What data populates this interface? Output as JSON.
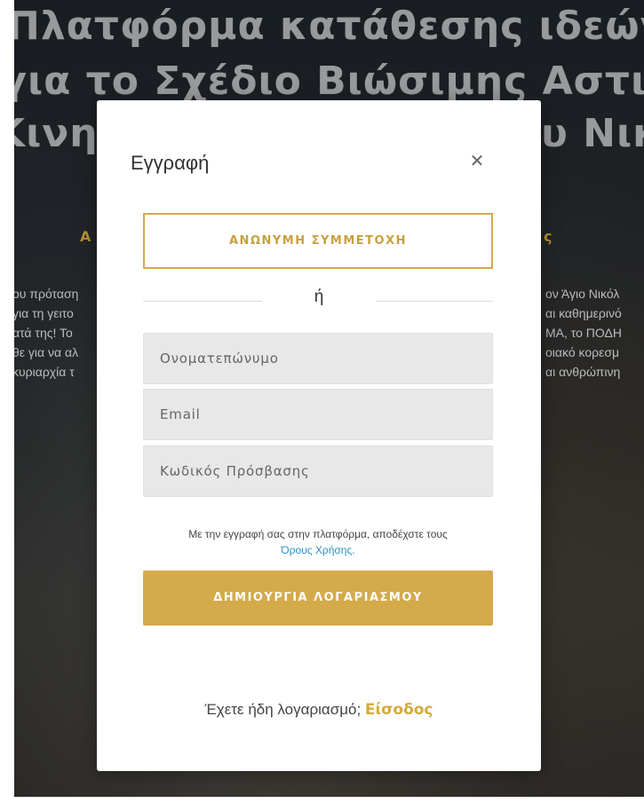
{
  "background": {
    "hero_lines": [
      "Πλατφόρμα κατάθεσης ιδεών",
      "για το Σχέδιο Βιώσιμης Αστικής",
      "Κινητικότητας του Αγίου Νικολάου"
    ],
    "subheading_left": "Α",
    "subheading_right": "ς",
    "paragraph_left_1": "ου πρόταση\nγια τη γειτο\nατά της! Το",
    "paragraph_right_1": "ον Άγιο Νικόλ\nαι καθημερινό\nΜΑ, το ΠΟΔΗ",
    "paragraph_left_2": "θε για να αλ\nκυριαρχία τ",
    "paragraph_right_2": "οιακό κορεσμ\nαι ανθρώπινη",
    "colors": {
      "accent": "#d4aa4a",
      "overlay": "#000000"
    }
  },
  "modal": {
    "title": "Εγγραφή",
    "close_icon": "close-icon",
    "anonymous_button": "ΑΝΩΝΥΜΗ ΣΥΜΜΕΤΟΧΗ",
    "or_text": "ή",
    "fields": {
      "fullname_placeholder": "Ονοματεπώνυμο",
      "email_placeholder": "Email",
      "password_placeholder": "Κωδικός Πρόσβασης"
    },
    "terms_text": "Με την εγγραφή σας στην πλατφόρμα, αποδέχστε τους",
    "terms_link": "Όρους Χρήσης.",
    "create_button": "ΔΗΜΙΟΥΡΓΙΑ ΛΟΓΑΡΙΑΣΜΟΥ",
    "login_prompt": "Έχετε ήδη λογαριασμό;",
    "login_link": "Είσοδος",
    "colors": {
      "accent": "#d4aa4a",
      "link": "#2a8fc5"
    }
  }
}
